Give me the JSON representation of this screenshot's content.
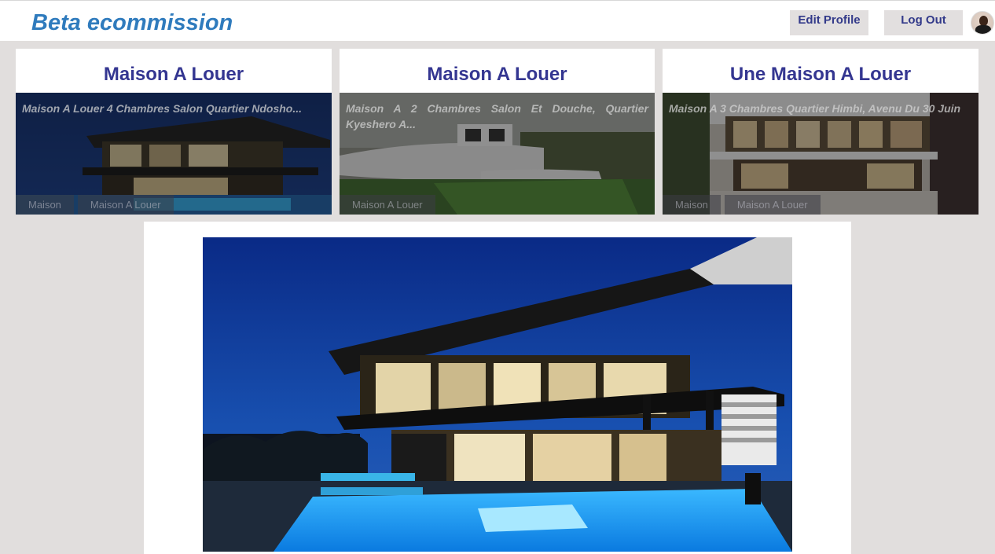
{
  "header": {
    "brand": "Beta ecommission",
    "edit_profile_label": "Edit Profile",
    "logout_label": "Log Out",
    "avatar_icon": "user-avatar-photo"
  },
  "listings": [
    {
      "title": "Maison A Louer",
      "description": "Maison A Louer 4 Chambres Salon Quartier Ndosho...",
      "tags": [
        "Maison",
        "Maison A Louer"
      ],
      "image": "modern-house-night-pool-photo"
    },
    {
      "title": "Maison A Louer",
      "description": "Maison A 2 Chambres Salon Et Douche, Quartier Kyeshero A...",
      "tags": [
        "Maison A Louer"
      ],
      "image": "white-modern-house-photo"
    },
    {
      "title": "Une Maison A Louer",
      "description": "Maison A 3 Chambres Quartier Himbi, Avenu Du 30 Juin",
      "tags": [
        "Maison",
        "Maison A Louer"
      ],
      "image": "modern-house-courtyard-photo"
    }
  ],
  "detail": {
    "image": "modern-house-night-pool-photo-large"
  },
  "colors": {
    "brand": "#2f7bbd",
    "title": "#343691",
    "background": "#e1dedd",
    "button_bg": "#e2dfdf"
  }
}
